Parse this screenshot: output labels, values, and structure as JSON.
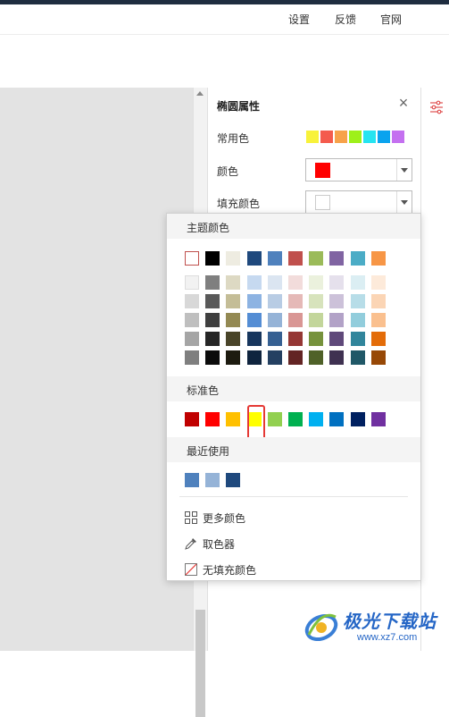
{
  "menu": {
    "settings": "设置",
    "feedback": "反馈",
    "website": "官网"
  },
  "panel": {
    "title": "椭圆属性",
    "common_colors_label": "常用色",
    "common_colors": [
      "#f8f23a",
      "#f45b4d",
      "#f7a24a",
      "#9ef01a",
      "#25e4f0",
      "#0aa3ee",
      "#c470f0"
    ],
    "color_label": "颜色",
    "color_value": "#ff0000",
    "fill_label": "填充颜色",
    "fill_value": "#ffffff",
    "percent_symbol": "%"
  },
  "dropdown": {
    "theme_label": "主题颜色",
    "theme_top_row": [
      "#ffffff",
      "#000000",
      "#eeece1",
      "#1f497d",
      "#4f81bd",
      "#c0504d",
      "#9bbb59",
      "#8064a2",
      "#4bacc6",
      "#f79646"
    ],
    "theme_shades": [
      [
        "#f2f2f2",
        "#7f7f7f",
        "#ddd9c3",
        "#c6d9f0",
        "#dbe5f1",
        "#f2dcdb",
        "#ebf1dd",
        "#e5e0ec",
        "#dbeef3",
        "#fdeada"
      ],
      [
        "#d8d8d8",
        "#595959",
        "#c4bd97",
        "#8db3e2",
        "#b8cce4",
        "#e5b9b7",
        "#d7e3bc",
        "#ccc1d9",
        "#b7dde8",
        "#fbd5b5"
      ],
      [
        "#bfbfbf",
        "#3f3f3f",
        "#938953",
        "#548dd4",
        "#95b3d7",
        "#d99694",
        "#c3d69b",
        "#b2a2c7",
        "#92cddc",
        "#fac08f"
      ],
      [
        "#a5a5a5",
        "#262626",
        "#494429",
        "#17365d",
        "#366092",
        "#953734",
        "#76923c",
        "#5f497a",
        "#31859b",
        "#e36c09"
      ],
      [
        "#7f7f7f",
        "#0c0c0c",
        "#1d1b10",
        "#0f243e",
        "#244061",
        "#632423",
        "#4f6128",
        "#3f3151",
        "#205867",
        "#974806"
      ]
    ],
    "standard_label": "标准色",
    "standard_colors": [
      "#c00000",
      "#ff0000",
      "#ffc000",
      "#ffff00",
      "#92d050",
      "#00b050",
      "#00b0f0",
      "#0070c0",
      "#002060",
      "#7030a0"
    ],
    "recent_label": "最近使用",
    "recent_colors": [
      "#4f81bd",
      "#95b3d7",
      "#1f497d"
    ],
    "more_colors": "更多颜色",
    "eyedropper": "取色器",
    "no_fill": "无填充颜色"
  },
  "watermark": {
    "brand": "极光下载站",
    "url": "www.xz7.com"
  },
  "colors": {
    "highlight": "#e53935",
    "accent": "#e05050"
  }
}
